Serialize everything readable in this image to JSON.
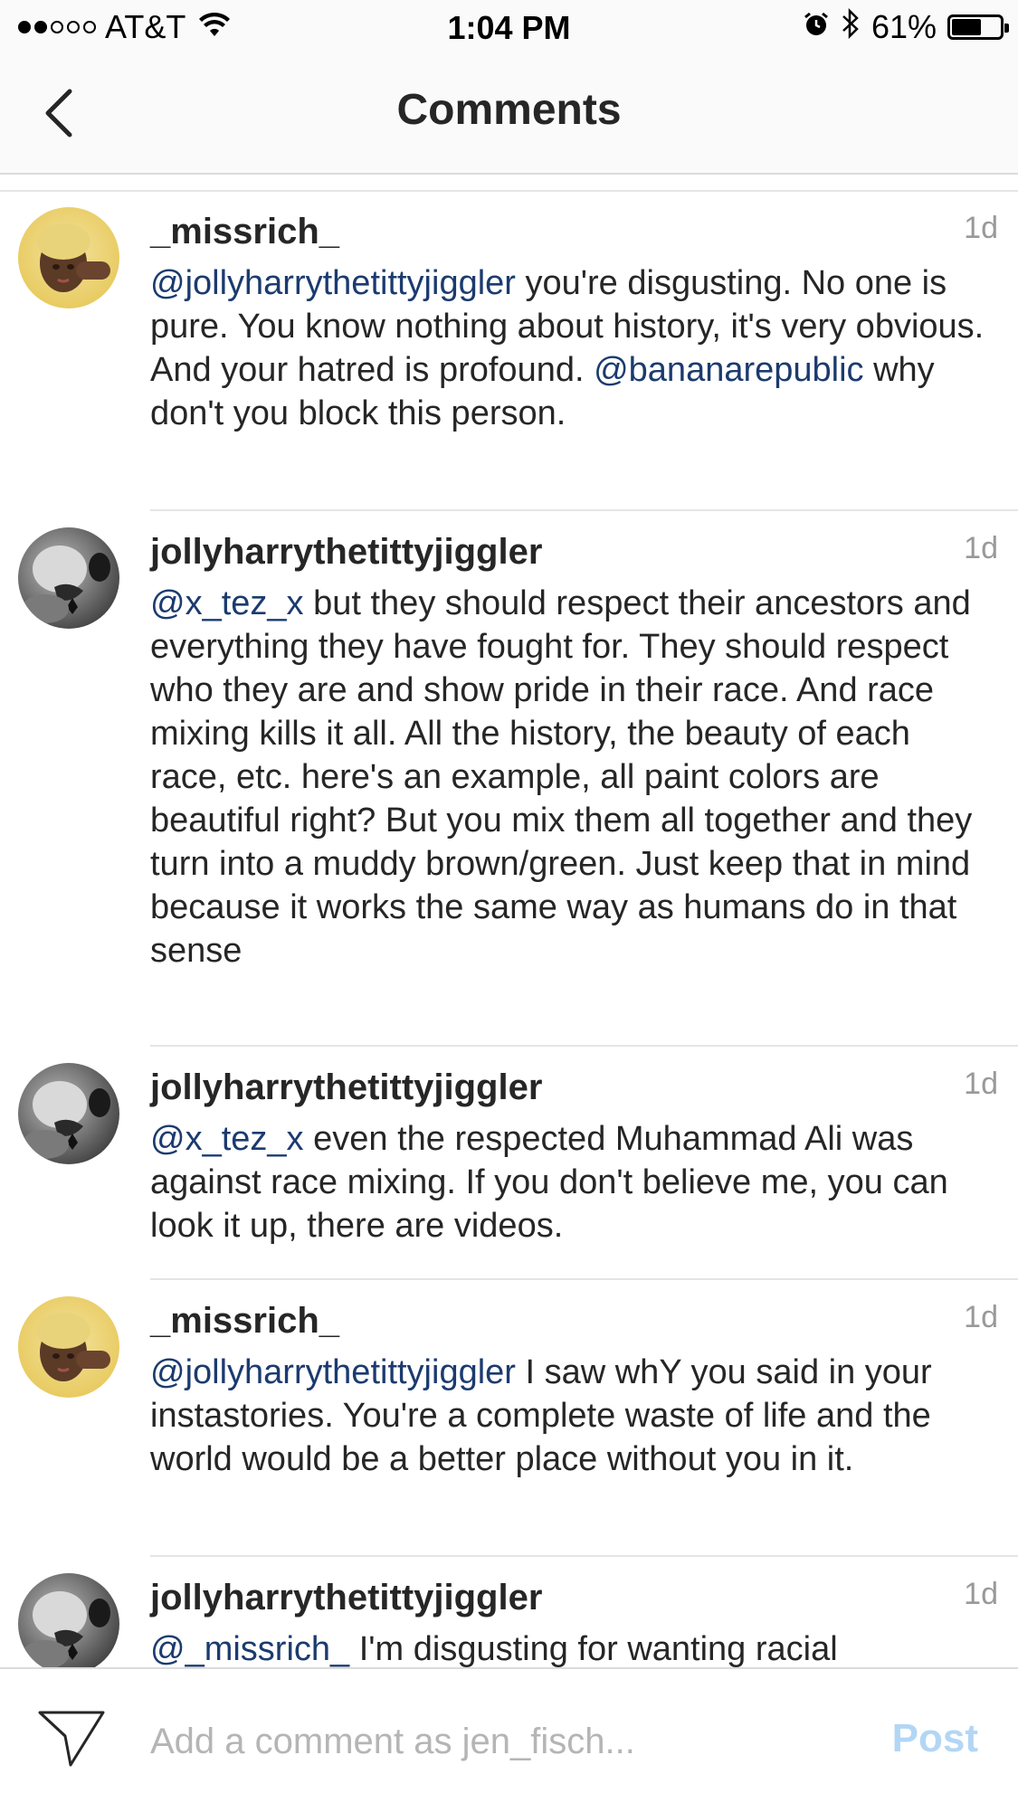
{
  "status_bar": {
    "carrier": "AT&T",
    "time": "1:04 PM",
    "battery_percent": "61%",
    "battery_level": 0.61,
    "signal_dots_filled": 2,
    "signal_dots_total": 5
  },
  "nav": {
    "title": "Comments",
    "back_icon": "chevron-left-icon"
  },
  "comments": [
    {
      "username": "_missrich_",
      "time": "1d",
      "avatar": "avatar-photo-missrich",
      "text_parts": [
        {
          "t": "@jollyharrythetittyjiggler",
          "mention": true
        },
        {
          "t": " you're disgusting. No one is pure. You know nothing about history, it's very obvious. And your hatred is profound. ",
          "mention": false
        },
        {
          "t": "@bananarepublic",
          "mention": true
        },
        {
          "t": " why don't you block this person.",
          "mention": false
        }
      ]
    },
    {
      "username": "jollyharrythetittyjiggler",
      "time": "1d",
      "avatar": "avatar-photo-jollyharry",
      "text_parts": [
        {
          "t": "@x_tez_x",
          "mention": true
        },
        {
          "t": " but they should respect their ancestors and everything they have fought for. They should respect who they are and show pride in their race. And race mixing kills it all. All the history, the beauty of each race, etc. here's an example, all paint colors are beautiful right? But you mix them all together and they turn into a muddy brown/green. Just keep that in mind because it works the same way as humans do in that sense",
          "mention": false
        }
      ]
    },
    {
      "username": "jollyharrythetittyjiggler",
      "time": "1d",
      "avatar": "avatar-photo-jollyharry",
      "text_parts": [
        {
          "t": "@x_tez_x",
          "mention": true
        },
        {
          "t": " even the respected Muhammad Ali was against race mixing. If you don't believe me, you can look it up, there are videos.",
          "mention": false
        }
      ]
    },
    {
      "username": "_missrich_",
      "time": "1d",
      "avatar": "avatar-photo-missrich",
      "text_parts": [
        {
          "t": "@jollyharrythetittyjiggler",
          "mention": true
        },
        {
          "t": " I saw whY you said in your instastories. You're a complete waste of life and the world would be a better place without you in it.",
          "mention": false
        }
      ]
    },
    {
      "username": "jollyharrythetittyjiggler",
      "time": "1d",
      "avatar": "avatar-photo-jollyharry",
      "text_parts": [
        {
          "t": "@_missrich_",
          "mention": true
        },
        {
          "t": " I'm disgusting for wanting racial",
          "mention": false
        }
      ]
    }
  ],
  "composer": {
    "placeholder": "Add a comment as jen_fisch...",
    "value": "",
    "post_label": "Post",
    "send_icon": "paper-plane-icon"
  },
  "colors": {
    "mention": "#1b3b6f",
    "text": "#262626",
    "timestamp": "#999999",
    "post_disabled": "#b3d6f5",
    "bar_background": "#fafafa",
    "divider": "#e5e5e5"
  }
}
